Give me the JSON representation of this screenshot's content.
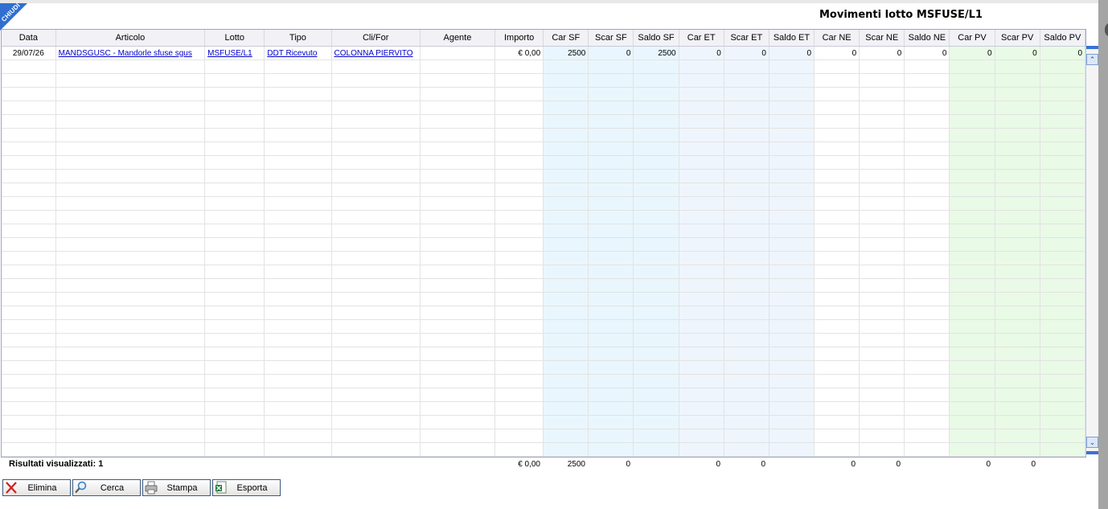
{
  "window": {
    "close_label": "CHIUDI",
    "title": "Movimenti lotto MSFUSE/L1"
  },
  "grid": {
    "columns": [
      "Data",
      "Articolo",
      "Lotto",
      "Tipo",
      "Cli/For",
      "Agente",
      "Importo",
      "Car SF",
      "Scar SF",
      "Saldo SF",
      "Car ET",
      "Scar ET",
      "Saldo ET",
      "Car NE",
      "Scar NE",
      "Saldo NE",
      "Car PV",
      "Scar PV",
      "Saldo PV"
    ],
    "rows": [
      {
        "data": "29/07/26",
        "articolo": "MANDSGUSC - Mandorle sfuse sgus",
        "lotto": "MSFUSE/L1",
        "tipo": "DDT Ricevuto",
        "clifor": "COLONNA PIERVITO",
        "agente": "",
        "importo": "€ 0,00",
        "car_sf": "2500",
        "scar_sf": "0",
        "saldo_sf": "2500",
        "car_et": "0",
        "scar_et": "0",
        "saldo_et": "0",
        "car_ne": "0",
        "scar_ne": "0",
        "saldo_ne": "0",
        "car_pv": "0",
        "scar_pv": "0",
        "saldo_pv": "0"
      }
    ]
  },
  "footer": {
    "results_label": "Risultati visualizzati: 1",
    "importo": "€ 0,00",
    "car_sf": "2500",
    "scar_sf": "0",
    "car_et": "0",
    "scar_et": "0",
    "car_ne": "0",
    "scar_ne": "0",
    "car_pv": "0",
    "scar_pv": "0"
  },
  "toolbar": {
    "delete_label": "Elimina",
    "search_label": "Cerca",
    "print_label": "Stampa",
    "export_label": "Esporta"
  },
  "colors": {
    "accent": "#2f6fd0",
    "link": "#0000cc",
    "sf_band": "#e9f6fd",
    "et_band": "#eff5fc",
    "pv_band": "#e9fae6"
  },
  "icons": {
    "delete": "close-x-icon",
    "search": "magnifier-icon",
    "print": "printer-icon",
    "export": "excel-icon",
    "scroll_up": "chevron-up-icon",
    "scroll_down": "chevron-down-icon"
  }
}
